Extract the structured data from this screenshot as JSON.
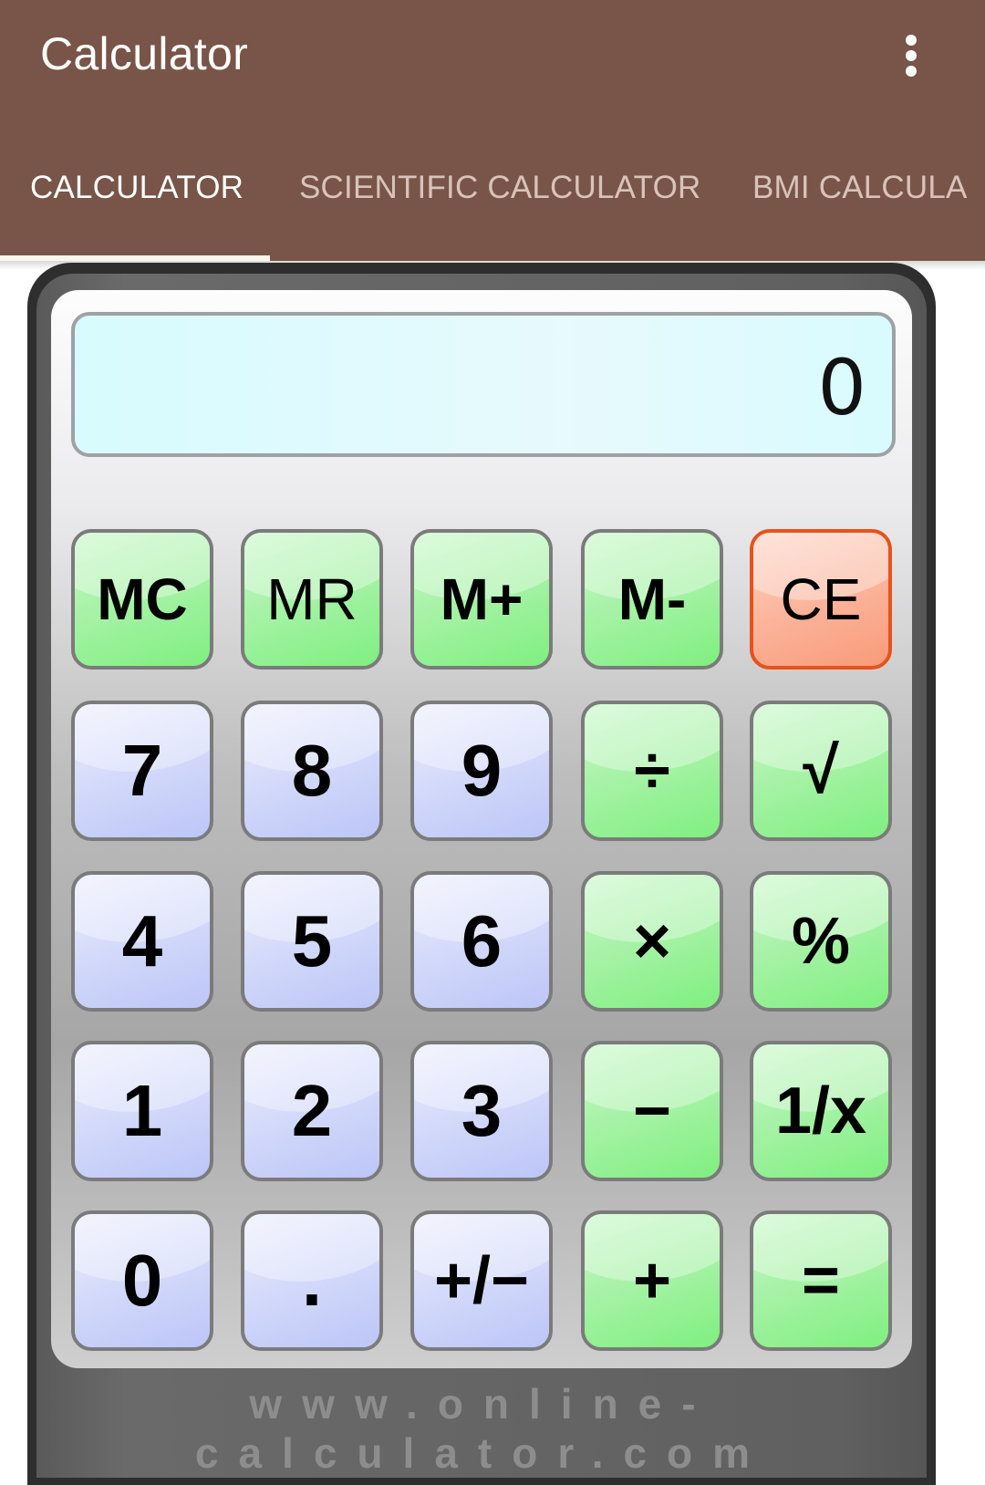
{
  "app_bar": {
    "title": "Calculator",
    "menu_icon": "more-vert-icon",
    "background": "#785548"
  },
  "tabs": [
    {
      "label": "CALCULATOR",
      "active": true
    },
    {
      "label": "SCIENTIFIC CALCULATOR",
      "active": false
    },
    {
      "label": "BMI CALCULA",
      "active": false
    }
  ],
  "calculator": {
    "display_value": "0",
    "footer_url": "www.online-calculator.com",
    "rows": [
      [
        {
          "label": "MC",
          "style": "green"
        },
        {
          "label": "MR",
          "style": "green"
        },
        {
          "label": "M+",
          "style": "green"
        },
        {
          "label": "M-",
          "style": "green"
        },
        {
          "label": "CE",
          "style": "red"
        }
      ],
      [
        {
          "label": "7",
          "style": "blue"
        },
        {
          "label": "8",
          "style": "blue"
        },
        {
          "label": "9",
          "style": "blue"
        },
        {
          "label": "÷",
          "style": "green"
        },
        {
          "label": "√",
          "style": "green"
        }
      ],
      [
        {
          "label": "4",
          "style": "blue"
        },
        {
          "label": "5",
          "style": "blue"
        },
        {
          "label": "6",
          "style": "blue"
        },
        {
          "label": "×",
          "style": "green"
        },
        {
          "label": "%",
          "style": "green"
        }
      ],
      [
        {
          "label": "1",
          "style": "blue"
        },
        {
          "label": "2",
          "style": "blue"
        },
        {
          "label": "3",
          "style": "blue"
        },
        {
          "label": "−",
          "style": "green"
        },
        {
          "label": "1/x",
          "style": "green"
        }
      ],
      [
        {
          "label": "0",
          "style": "blue"
        },
        {
          "label": ".",
          "style": "blue"
        },
        {
          "label": "+/−",
          "style": "blue"
        },
        {
          "label": "+",
          "style": "green"
        },
        {
          "label": "=",
          "style": "green"
        }
      ]
    ]
  }
}
